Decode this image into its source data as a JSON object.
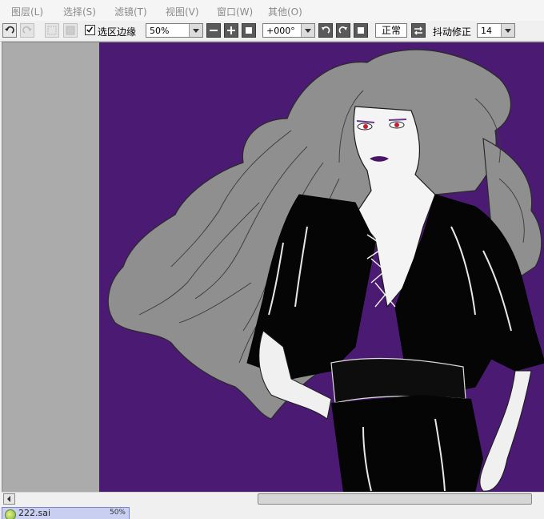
{
  "menu": [
    {
      "label": "图层(L)"
    },
    {
      "label": "选择(S)"
    },
    {
      "label": "滤镜(T)"
    },
    {
      "label": "视图(V)"
    },
    {
      "label": "窗口(W)"
    },
    {
      "label": "其他(O)"
    }
  ],
  "toolbar": {
    "selection_edge_label": "选区边缘",
    "selection_edge_checked": true,
    "zoom_value": "50%",
    "rotation_value": "+000°",
    "blend_mode_label": "正常",
    "stabilizer_label": "抖动修正",
    "stabilizer_value": "14"
  },
  "icons": {
    "undo": "undo-icon",
    "redo": "redo-icon",
    "deselect": "deselect-icon",
    "invert_selection": "invert-selection-icon",
    "zoom_out": "minus-icon",
    "zoom_in": "plus-icon",
    "zoom_reset": "square-icon",
    "rotate_ccw": "rotate-left-icon",
    "rotate_cw": "rotate-right-icon",
    "rotate_reset": "square-icon",
    "flip": "flip-horizontal-icon"
  },
  "colors": {
    "canvas_background": "#4b1a72",
    "workspace_gray": "#ababab",
    "tab_highlight": "#c8cff0"
  },
  "document_tab": {
    "name": "222.sai",
    "zoom": "50%"
  },
  "scroll": {
    "horizontal_position": 0.47
  }
}
